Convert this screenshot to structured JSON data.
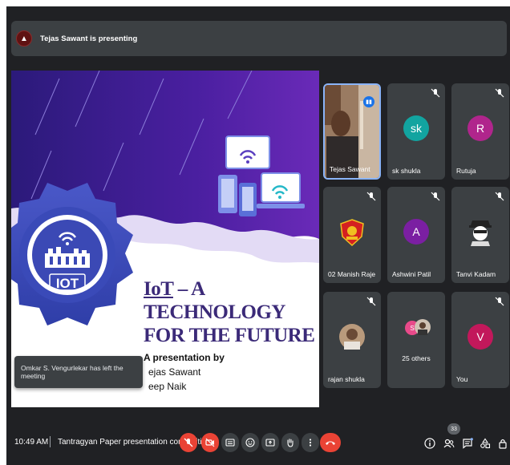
{
  "presenting_bar": {
    "text": "Tejas Sawant is presenting"
  },
  "slide": {
    "title_word": "IoT",
    "title_rest": " – A TECHNOLOGY FOR THE FUTURE",
    "byline": "A presentation by",
    "presenter_1": "ejas Sawant",
    "presenter_2": "eep Naik",
    "logo_text": "IOT"
  },
  "toast": {
    "text": "Omkar S. Vengurlekar has left the meeting"
  },
  "participants": [
    {
      "name": "Tejas Sawant",
      "initial": "",
      "color": ""
    },
    {
      "name": "sk shukla",
      "initial": "sk",
      "color": "#12a4a0"
    },
    {
      "name": "Rutuja",
      "initial": "R",
      "color": "#b0258c"
    },
    {
      "name": "02 Manish Raje",
      "initial": "",
      "color": ""
    },
    {
      "name": "Ashwini Patil",
      "initial": "A",
      "color": "#7b1fa2"
    },
    {
      "name": "Tanvi Kadam",
      "initial": "",
      "color": ""
    },
    {
      "name": "rajan shukla",
      "initial": "",
      "color": ""
    },
    {
      "name": "25 others",
      "initial": "S",
      "color": "#e84a8a"
    },
    {
      "name": "You",
      "initial": "V",
      "color": "#c2185b"
    }
  ],
  "bottom_bar": {
    "time": "10:49 AM",
    "meeting_title": "Tantragyan Paper presentation competiti...",
    "people_count": "33"
  },
  "colors": {
    "frame_bg": "#202124",
    "tile_bg": "#3c4043",
    "leave_red": "#ea4335",
    "active_border": "#8ab4f8"
  }
}
